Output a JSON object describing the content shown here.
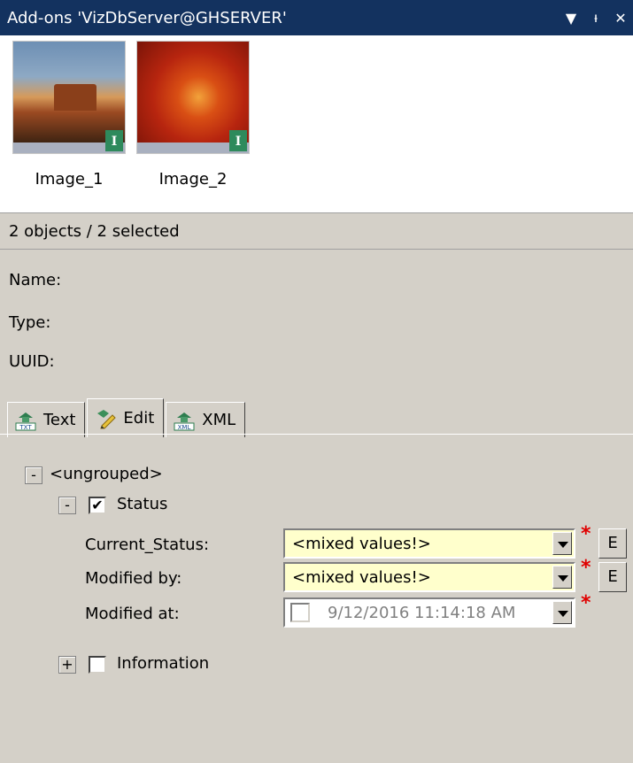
{
  "window": {
    "title": "Add-ons 'VizDbServer@GHSERVER'",
    "menu_glyph": "▼",
    "pin_glyph": "ᵼ",
    "close_glyph": "✕"
  },
  "thumbnails": [
    {
      "caption": "Image_1",
      "badge": "I"
    },
    {
      "caption": "Image_2",
      "badge": "I"
    }
  ],
  "status": {
    "text": "2 objects / 2 selected"
  },
  "properties": {
    "name_label": "Name:",
    "type_label": "Type:",
    "uuid_label": "UUID:"
  },
  "tabs": [
    {
      "label": "Text",
      "icon": "txt-icon"
    },
    {
      "label": "Edit",
      "icon": "edit-icon"
    },
    {
      "label": "XML",
      "icon": "xml-icon"
    }
  ],
  "tree": {
    "group": {
      "toggle": "-",
      "label": "<ungrouped>"
    },
    "status_node": {
      "toggle": "-",
      "checked_glyph": "✔",
      "label": "Status"
    },
    "fields": [
      {
        "label": "Current_Status:",
        "value": "<mixed values!>",
        "required": "*",
        "edit": "E"
      },
      {
        "label": "Modified by:",
        "value": "<mixed values!>",
        "required": "*",
        "edit": "E"
      },
      {
        "label": "Modified at:",
        "value": "9/12/2016 11:14:18 AM",
        "required": "*"
      }
    ],
    "info_node": {
      "toggle": "+",
      "label": "Information"
    }
  },
  "colors": {
    "titlebar": "#13325f",
    "panel": "#d4d0c8",
    "combo_highlight": "#ffffcc",
    "required": "#e00000"
  }
}
